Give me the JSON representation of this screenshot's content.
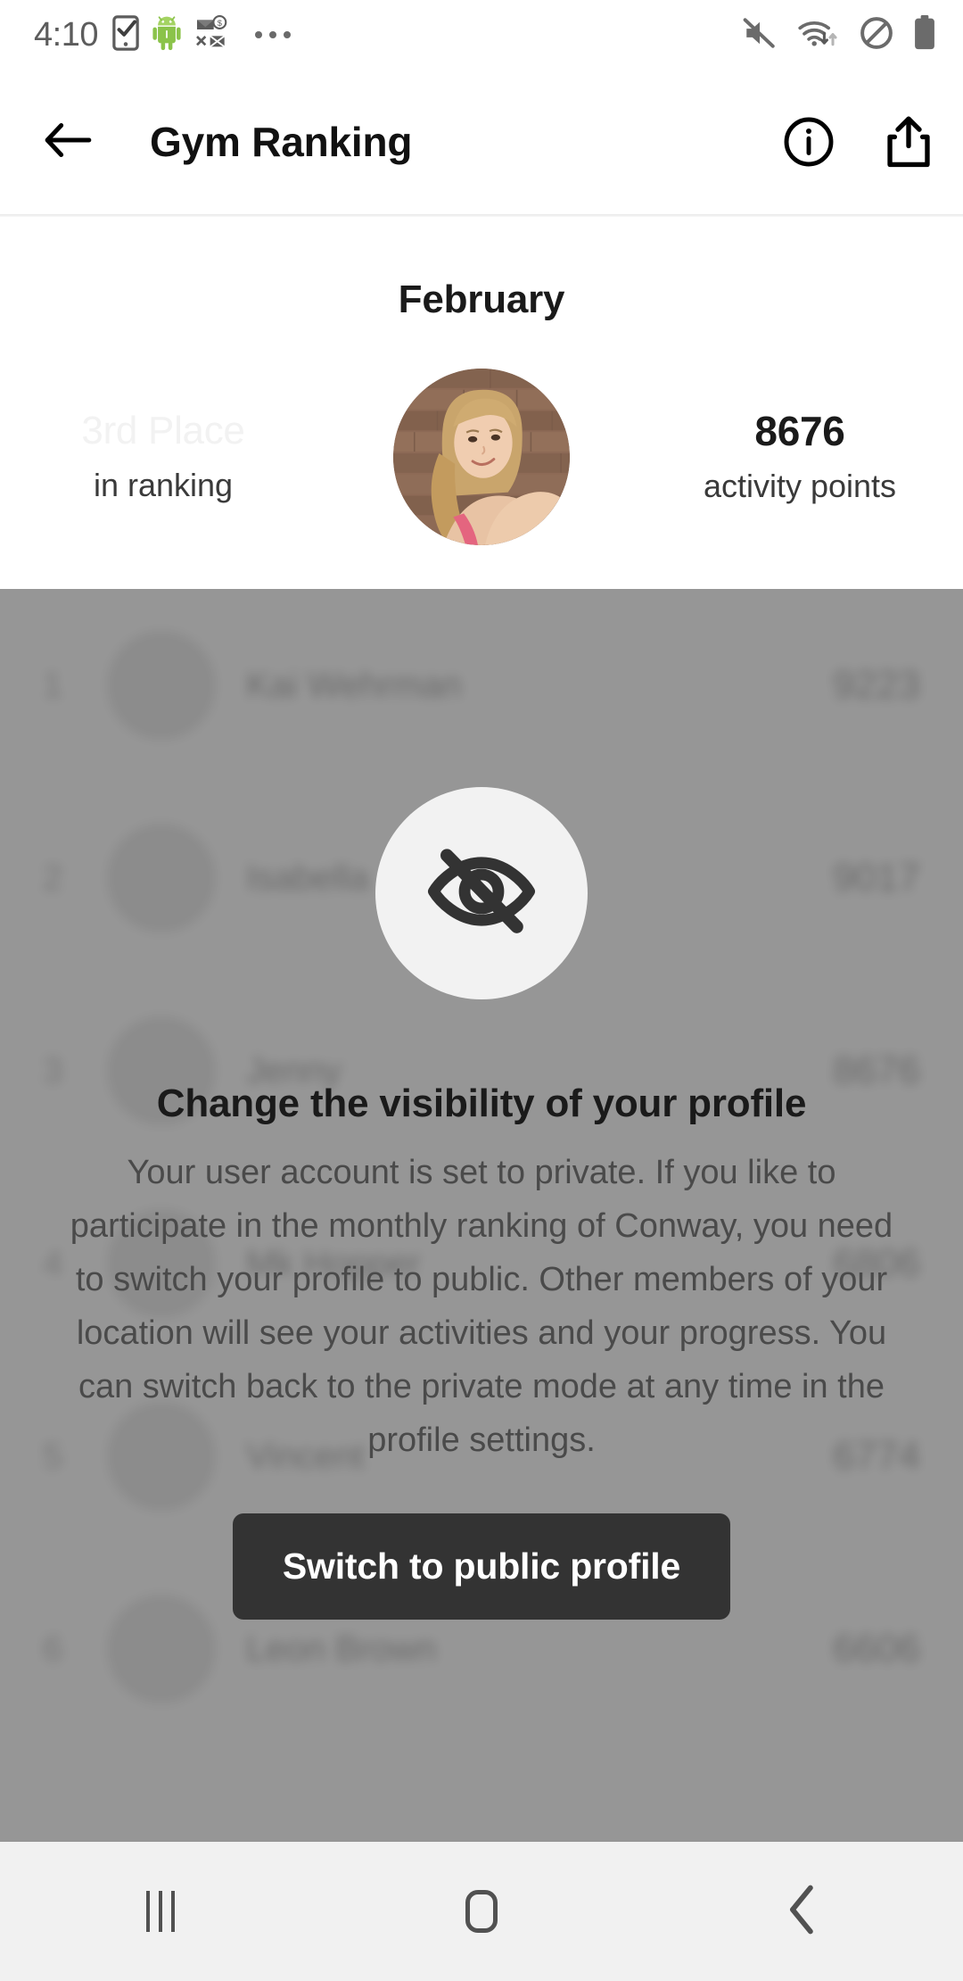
{
  "statusbar": {
    "time": "4:10",
    "left_icons": [
      "phone-check-icon",
      "android-robot-icon",
      "mail-blocked-icon",
      "more-dots-icon"
    ],
    "right_icons": [
      "volume-muted-icon",
      "wifi-icon",
      "do-not-disturb-icon",
      "battery-full-icon"
    ]
  },
  "appbar": {
    "back_label": "back-arrow",
    "title": "Gym Ranking",
    "info_label": "info",
    "share_label": "share"
  },
  "header": {
    "month": "February",
    "place_value": "3rd Place",
    "place_caption": "in ranking",
    "points_value": "8676",
    "points_caption": "activity points",
    "avatar_alt": "user-avatar"
  },
  "ranking": {
    "rows": [
      {
        "rank": "1",
        "name": "Kai Wehrman",
        "points": "9223"
      },
      {
        "rank": "2",
        "name": "Isabella",
        "points": "9017"
      },
      {
        "rank": "3",
        "name": "Jenny",
        "points": "8676"
      },
      {
        "rank": "4",
        "name": "Mk Hopper",
        "points": "6806"
      },
      {
        "rank": "5",
        "name": "Vincent",
        "points": "6774"
      },
      {
        "rank": "6",
        "name": "Leon Brown",
        "points": "6606"
      }
    ]
  },
  "overlay": {
    "icon": "eye-off-icon",
    "title": "Change the visibility of your profile",
    "body": "Your user account is set to private. If you like to participate in the monthly ranking of Conway, you need to switch your profile to public. Other members of your location will see your activities and your progress. You can switch back to the private mode at any time in the profile settings.",
    "button_label": "Switch to public profile"
  },
  "navbar": {
    "recents_label": "recents",
    "home_label": "home",
    "back_label": "back"
  },
  "colors": {
    "button_bg": "#333333",
    "scrim": "#989898",
    "accent_text": "#1a1a1a"
  }
}
